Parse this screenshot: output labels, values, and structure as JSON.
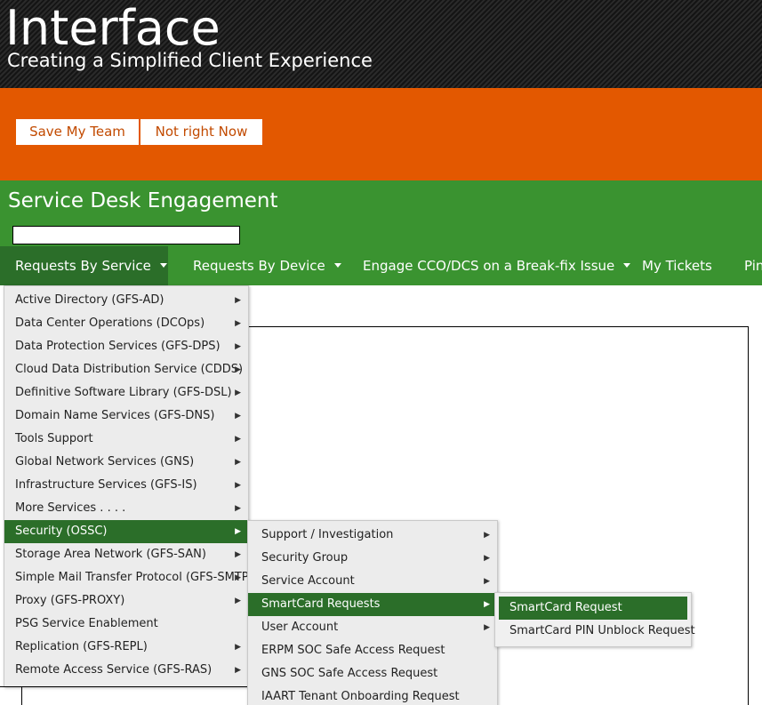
{
  "header": {
    "title": "Interface",
    "subtitle": "Creating a Simplified Client Experience"
  },
  "banner": {
    "save_label": "Save My Team",
    "not_now_label": "Not right Now"
  },
  "section": {
    "title": "Service Desk Engagement",
    "search_value": ""
  },
  "nav": {
    "items": [
      {
        "label": "Requests By Service",
        "has_caret": true
      },
      {
        "label": "Requests By Device",
        "has_caret": true
      },
      {
        "label": "Engage CCO/DCS on a Break-fix Issue",
        "has_caret": true
      },
      {
        "label": "My Tickets",
        "has_caret": false
      },
      {
        "label": "Pin",
        "has_caret": false
      }
    ]
  },
  "menu_services": {
    "items": [
      {
        "label": "Active Directory (GFS-AD)"
      },
      {
        "label": "Data Center Operations (DCOps)"
      },
      {
        "label": "Data Protection Services (GFS-DPS)"
      },
      {
        "label": "Cloud Data Distribution Service (CDDS)"
      },
      {
        "label": "Definitive Software Library (GFS-DSL)"
      },
      {
        "label": "Domain Name Services (GFS-DNS)"
      },
      {
        "label": "Tools Support"
      },
      {
        "label": "Global Network Services (GNS)"
      },
      {
        "label": "Infrastructure Services (GFS-IS)"
      },
      {
        "label": "More Services . . . ."
      },
      {
        "label": "Security (OSSC)"
      },
      {
        "label": "Storage Area Network (GFS-SAN)"
      },
      {
        "label": "Simple Mail Transfer Protocol (GFS-SMTP)"
      },
      {
        "label": "Proxy (GFS-PROXY)"
      },
      {
        "label": "PSG Service Enablement"
      },
      {
        "label": "Replication (GFS-REPL)"
      },
      {
        "label": "Remote Access Service (GFS-RAS)"
      }
    ]
  },
  "menu_security": {
    "items": [
      {
        "label": "Support / Investigation"
      },
      {
        "label": "Security Group"
      },
      {
        "label": "Service Account"
      },
      {
        "label": "SmartCard Requests"
      },
      {
        "label": "User Account"
      },
      {
        "label": "ERPM SOC Safe Access Request"
      },
      {
        "label": "GNS SOC Safe Access Request"
      },
      {
        "label": "IAART Tenant Onboarding Request"
      }
    ]
  },
  "menu_smartcard": {
    "items": [
      {
        "label": "SmartCard Request"
      },
      {
        "label": "SmartCard PIN Unblock Request"
      }
    ]
  },
  "colors": {
    "header_bg": "#1b1b1b",
    "orange": "#e35800",
    "green": "#3a9330",
    "green_dark": "#2b6e29",
    "menu_bg": "#ececec"
  }
}
